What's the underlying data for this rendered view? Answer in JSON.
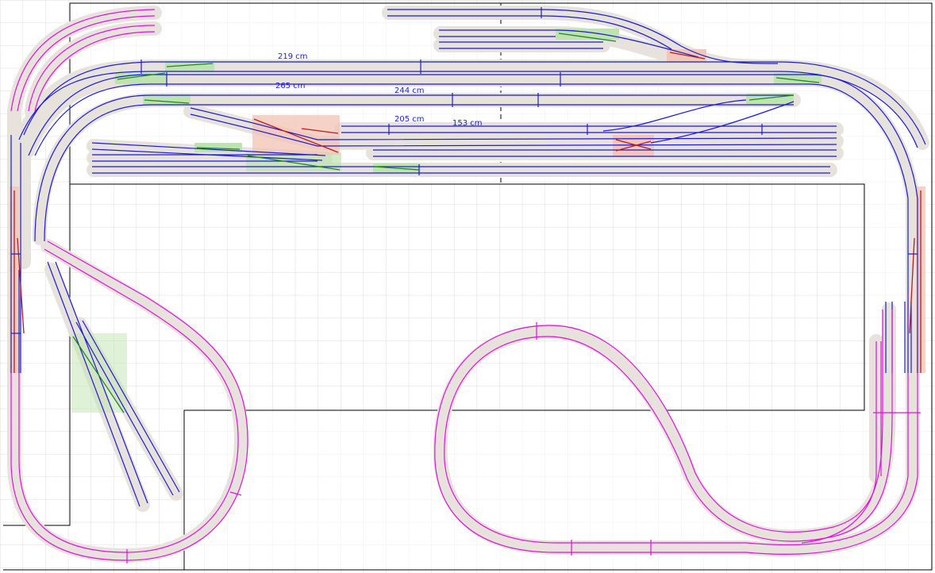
{
  "colors": {
    "background": "#ffffff",
    "grid": "#dcdcdc",
    "board_outline": "#000000",
    "ballast": "#e8e2dc",
    "track_level_lower": "#1a1ad8",
    "track_level_ramp": "#e010e0",
    "turnout_standard": "#1c8a1c",
    "turnout_curved": "#b81c1c",
    "turnout_fill_green": "#bfe3b0",
    "turnout_fill_red": "#f2c6b8",
    "dimension_text": "#1a1ad8"
  },
  "measurements": [
    {
      "id": "m1",
      "label": "219 cm"
    },
    {
      "id": "m2",
      "label": "265 cm"
    },
    {
      "id": "m3",
      "label": "244 cm"
    },
    {
      "id": "m4",
      "label": "205 cm"
    },
    {
      "id": "m5",
      "label": "153 cm"
    }
  ]
}
